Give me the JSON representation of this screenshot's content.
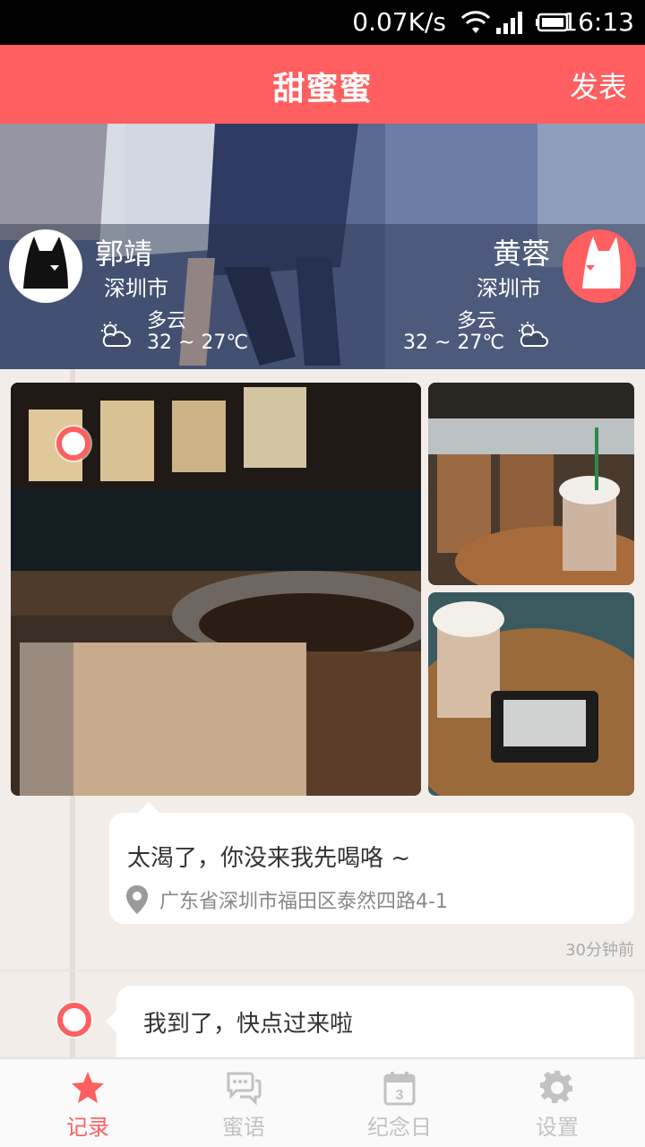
{
  "status_bar": {
    "speed": "0.07K/s",
    "time": "16:13"
  },
  "app_bar": {
    "title": "甜蜜蜜",
    "post_label": "发表"
  },
  "profile_left": {
    "name": "郭靖",
    "city": "深圳市",
    "weather": "多云",
    "temp": "32 ~ 27℃"
  },
  "profile_right": {
    "name": "黄蓉",
    "city": "深圳市",
    "weather": "多云",
    "temp": "32 ~ 27℃"
  },
  "posts": [
    {
      "text": "太渴了，你没来我先喝咯 ~",
      "location": "广东省深圳市福田区泰然四路4-1",
      "time_ago": "30分钟前"
    },
    {
      "text": "我到了，快点过来啦"
    }
  ],
  "nav": [
    {
      "label": "记录",
      "icon": "star-icon",
      "active": true
    },
    {
      "label": "蜜语",
      "icon": "chat-bubbles-icon",
      "active": false
    },
    {
      "label": "纪念日",
      "icon": "calendar-icon",
      "active": false
    },
    {
      "label": "设置",
      "icon": "gear-icon",
      "active": false
    }
  ],
  "colors": {
    "accent": "#ff5f60",
    "background": "#f3ede9",
    "nav_inactive": "#c2c2c2"
  }
}
